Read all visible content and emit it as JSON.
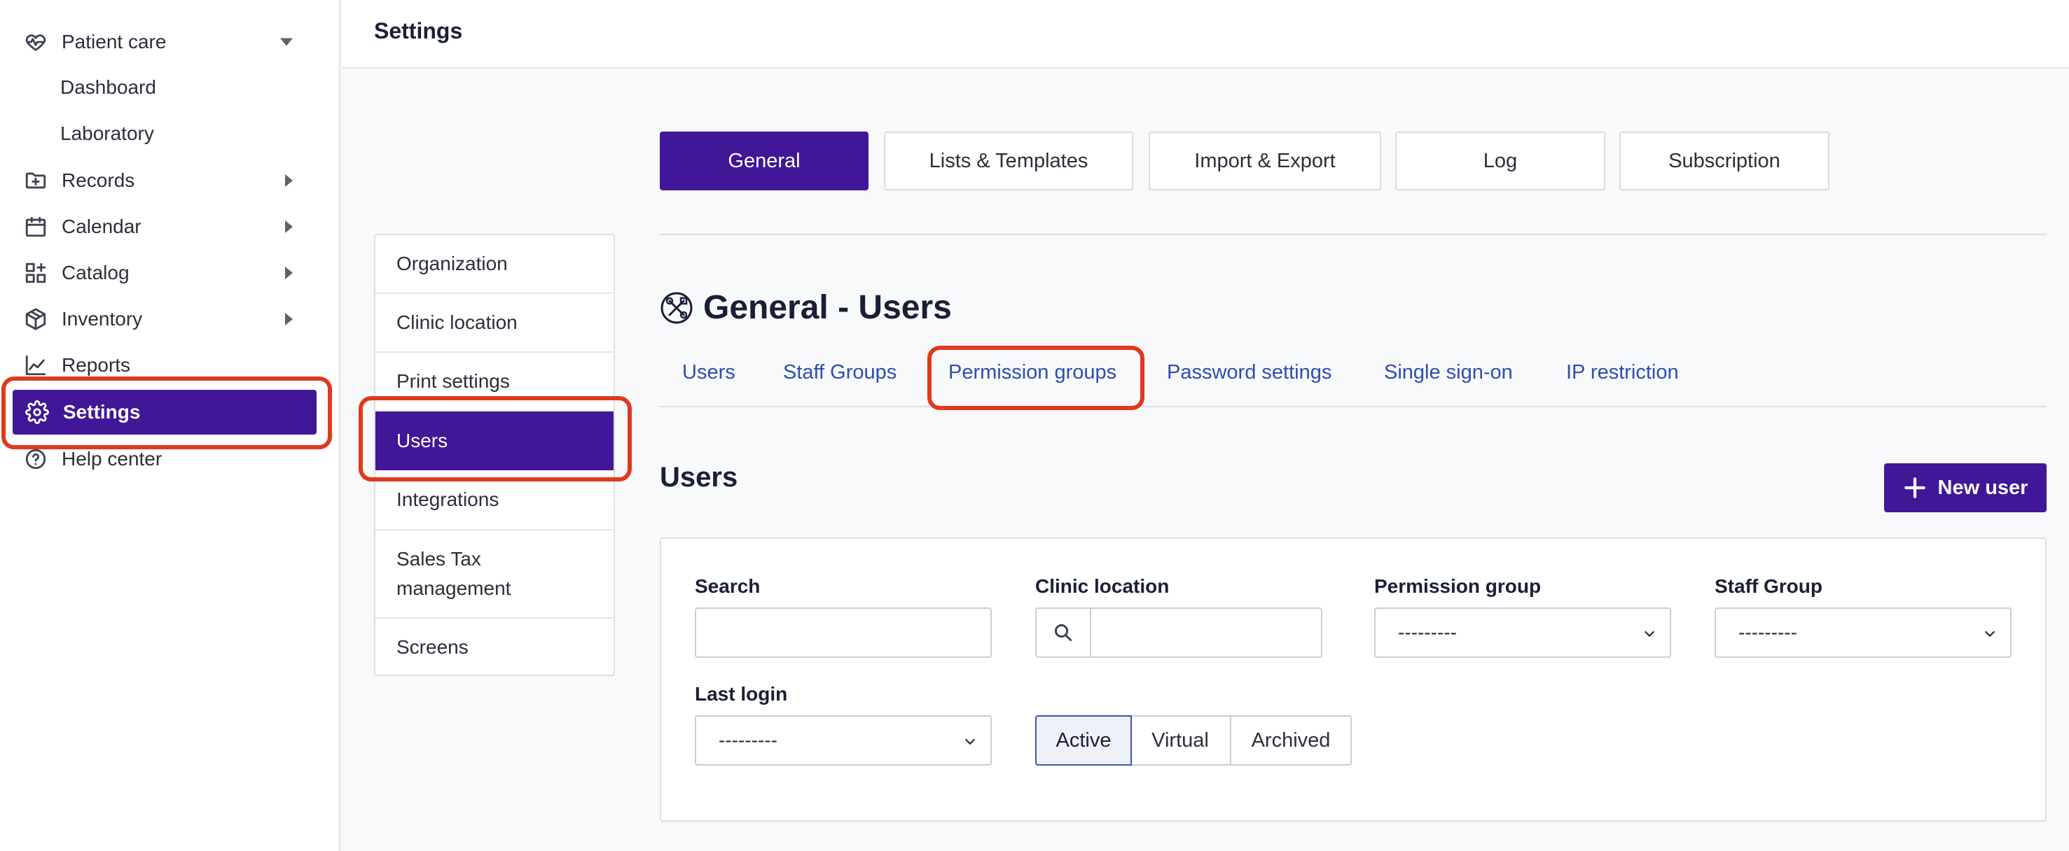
{
  "sidebar": {
    "patient_care": "Patient care",
    "dashboard": "Dashboard",
    "laboratory": "Laboratory",
    "records": "Records",
    "calendar": "Calendar",
    "catalog": "Catalog",
    "inventory": "Inventory",
    "reports": "Reports",
    "settings": "Settings",
    "help_center": "Help center"
  },
  "header": {
    "title": "Settings"
  },
  "top_tabs": {
    "general": "General",
    "lists_templates": "Lists & Templates",
    "import_export": "Import & Export",
    "log": "Log",
    "subscription": "Subscription"
  },
  "submenu": {
    "organization": "Organization",
    "clinic_location": "Clinic location",
    "print_settings": "Print settings",
    "users": "Users",
    "integrations": "Integrations",
    "sales_tax_line1": "Sales Tax",
    "sales_tax_line2": "management",
    "screens": "Screens"
  },
  "main": {
    "title": "General - Users",
    "sub_tabs": {
      "users": "Users",
      "staff_groups": "Staff Groups",
      "permission_groups": "Permission groups",
      "password_settings": "Password settings",
      "single_sign_on": "Single sign-on",
      "ip_restriction": "IP restriction"
    },
    "section_title": "Users",
    "new_user_label": "New user"
  },
  "filters": {
    "search_label": "Search",
    "search_value": "",
    "clinic_location_label": "Clinic location",
    "clinic_location_value": "",
    "permission_group_label": "Permission group",
    "permission_group_value": "---------",
    "staff_group_label": "Staff Group",
    "staff_group_value": "---------",
    "last_login_label": "Last login",
    "last_login_value": "---------",
    "status_active": "Active",
    "status_virtual": "Virtual",
    "status_archived": "Archived"
  },
  "colors": {
    "brand": "#3f1797",
    "link": "#2d4db3",
    "highlight": "#e0391f"
  }
}
